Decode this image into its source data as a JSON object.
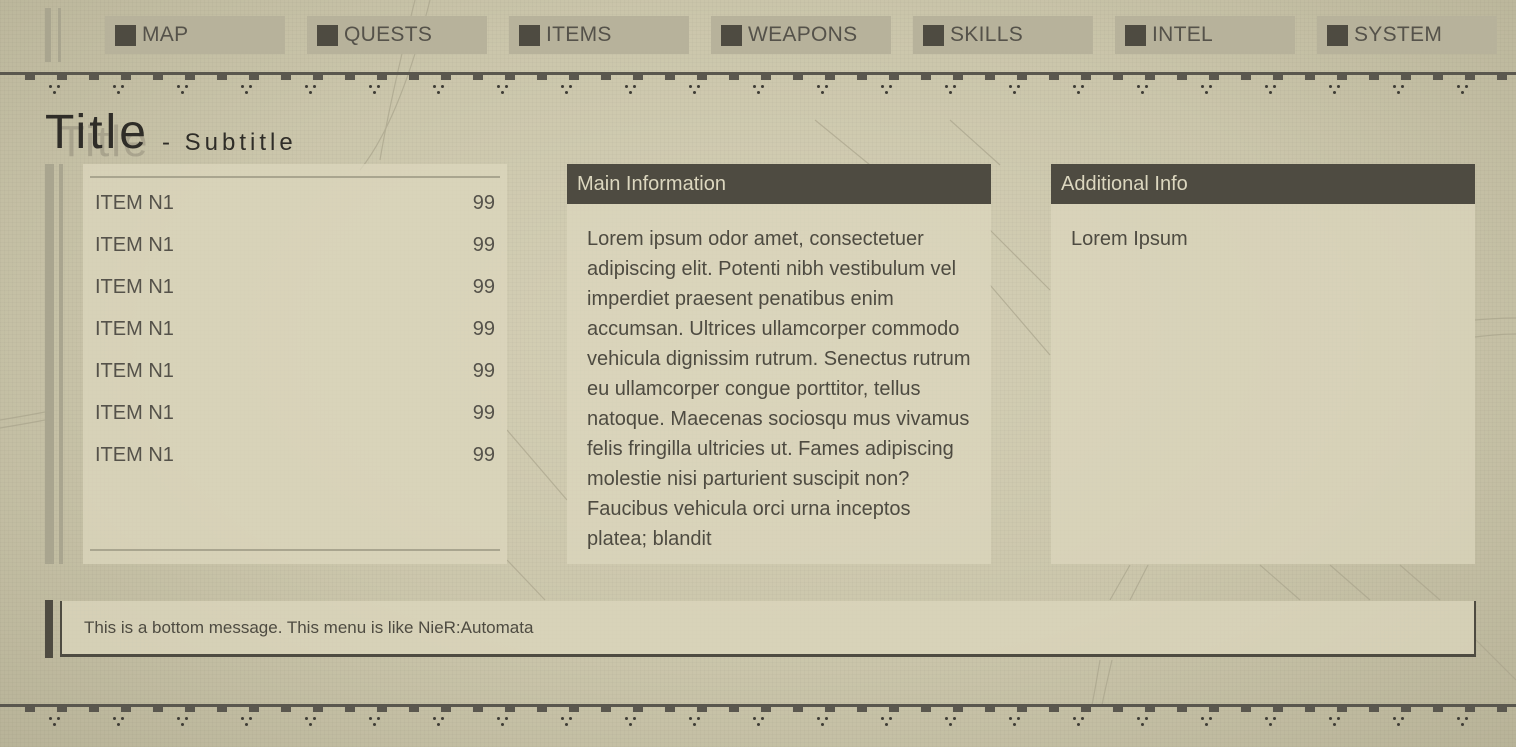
{
  "nav": {
    "items": [
      {
        "label": "MAP"
      },
      {
        "label": "QUESTS"
      },
      {
        "label": "ITEMS"
      },
      {
        "label": "WEAPONS"
      },
      {
        "label": "SKILLS"
      },
      {
        "label": "INTEL"
      },
      {
        "label": "SYSTEM"
      }
    ]
  },
  "header": {
    "title": "Title",
    "subtitle": "- Subtitle"
  },
  "list": {
    "items": [
      {
        "name": "ITEM N1",
        "count": "99"
      },
      {
        "name": "ITEM N1",
        "count": "99"
      },
      {
        "name": "ITEM N1",
        "count": "99"
      },
      {
        "name": "ITEM N1",
        "count": "99"
      },
      {
        "name": "ITEM N1",
        "count": "99"
      },
      {
        "name": "ITEM N1",
        "count": "99"
      },
      {
        "name": "ITEM N1",
        "count": "99"
      }
    ]
  },
  "main_info": {
    "heading": "Main Information",
    "body": "Lorem ipsum odor amet, consectetuer adipiscing elit. Potenti nibh vestibulum vel imperdiet praesent penatibus enim accumsan. Ultrices ullamcorper commodo vehicula dignissim rutrum. Senectus rutrum eu ullamcorper congue porttitor, tellus natoque. Maecenas sociosqu mus vivamus felis fringilla ultricies ut. Fames adipiscing molestie nisi parturient suscipit non? Faucibus vehicula orci urna inceptos platea; blandit"
  },
  "additional_info": {
    "heading": "Additional Info",
    "body": "Lorem Ipsum"
  },
  "footer": {
    "message": "This is a bottom message. This menu is like NieR:Automata"
  },
  "colors": {
    "background": "#cbc6ab",
    "panel": "#dcd7be",
    "dark": "#4e4b41",
    "nav_tab": "#b7b29b"
  }
}
